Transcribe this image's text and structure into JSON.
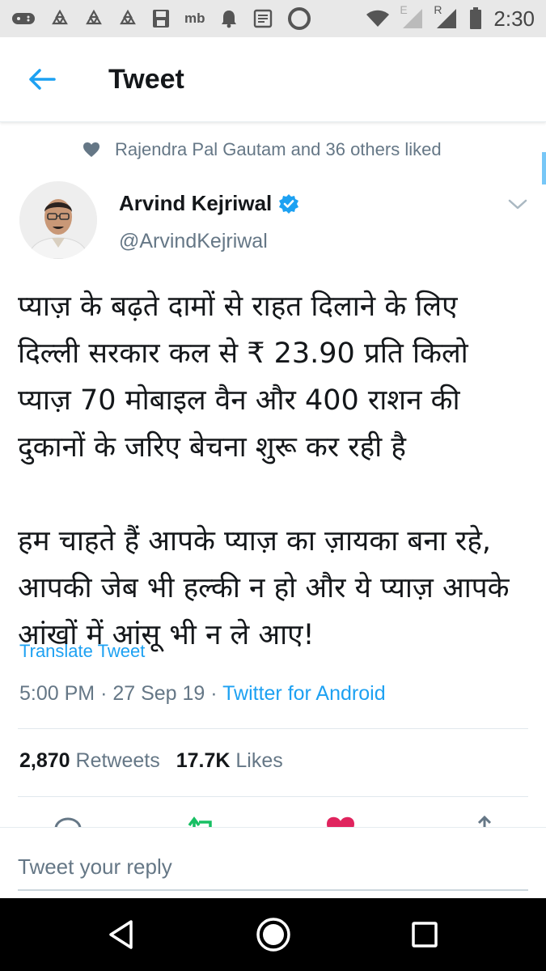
{
  "status_bar": {
    "network_label": "mb",
    "signal_label_e": "E",
    "signal_label_r": "R",
    "time": "2:30"
  },
  "header": {
    "title": "Tweet"
  },
  "social_context": {
    "text": "Rajendra Pal Gautam and 36 others liked"
  },
  "author": {
    "name": "Arvind Kejriwal",
    "handle": "@ArvindKejriwal"
  },
  "tweet": {
    "paragraph1": "प्याज़ के बढ़ते दामों से राहत दिलाने के लिए दिल्ली सरकार कल से ₹ 23.90 प्रति किलो प्याज़ 70 मोबाइल वैन और 400 राशन की दुकानों के जरिए बेचना शुरू कर रही है",
    "paragraph2": "हम चाहते हैं आपके प्याज़ का ज़ायका बना रहे, आपकी जेब भी हल्की न हो और ये प्याज़ आपके आंखों में आंसू भी न ले आए!",
    "translate_label": "Translate Tweet",
    "time": "5:00 PM",
    "date": "27 Sep 19",
    "separator": "·",
    "source": "Twitter for Android"
  },
  "stats": {
    "retweets_count": "2,870",
    "retweets_label": "Retweets",
    "likes_count": "17.7K",
    "likes_label": "Likes"
  },
  "reply": {
    "placeholder": "Tweet your reply"
  },
  "colors": {
    "accent": "#1da1f2",
    "secondary_text": "#657786",
    "retweet_green": "#17bf63",
    "like_red": "#e0245e"
  }
}
